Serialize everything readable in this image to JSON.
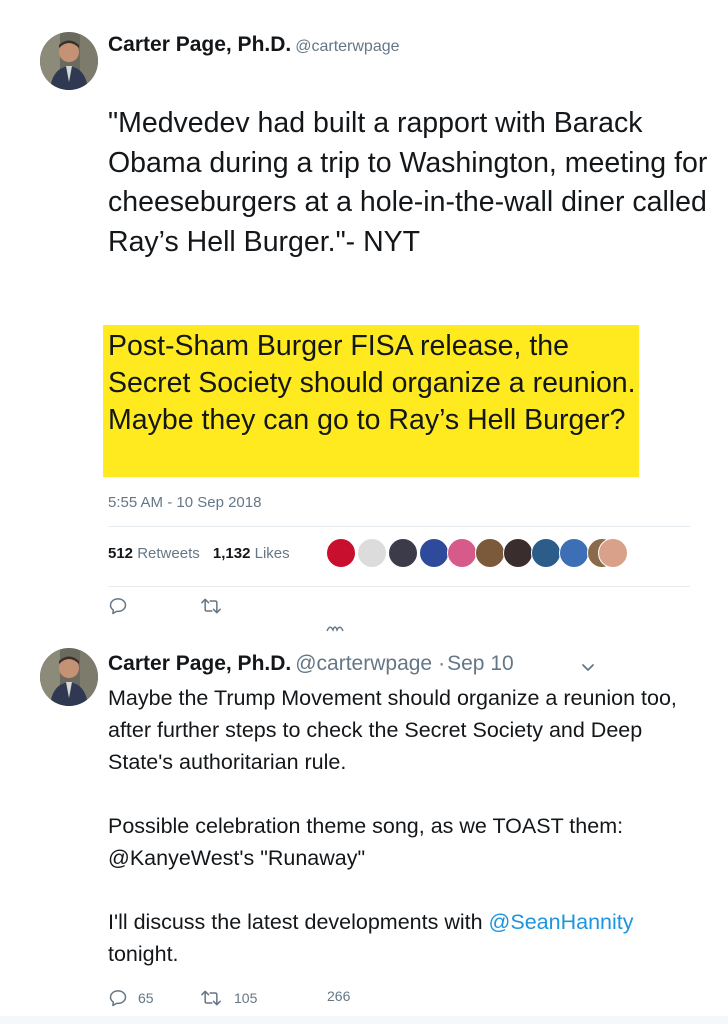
{
  "tweet1": {
    "author_name": "Carter Page, Ph.D.",
    "author_handle": "@carterwpage",
    "quote_text": "\"Medvedev had built a rapport with Barack Obama during a trip to Washington, meeting for cheeseburgers at a hole-in-the-wall diner called Ray’s Hell Burger.\"- NYT",
    "highlight_text": "Post-Sham Burger FISA release, the Secret Society should organize a reunion. Maybe they can go to Ray’s Hell Burger?",
    "timestamp": "5:55 AM - 10 Sep 2018",
    "retweets_count": "512",
    "retweets_label": "Retweets",
    "likes_count": "1,132",
    "likes_label": "Likes",
    "liker_colors": [
      "#c8102e",
      "#dcdcdc",
      "#3b3b4a",
      "#2e4b9b",
      "#d65a8a",
      "#7a5a3a",
      "#3a2d2d",
      "#2b5c8a",
      "#3c6fb5",
      "#8a6a4a",
      "#d9a08a"
    ]
  },
  "tweet2": {
    "author_name": "Carter Page, Ph.D.",
    "author_handle": "@carterwpage",
    "dot": "·",
    "date": "Sep 10",
    "line1": "Maybe the Trump Movement should organize a reunion too, after further steps to check the Secret Society and Deep State's authoritarian rule.",
    "line2": "Possible celebration theme song, as we TOAST them: @KanyeWest's \"Runaway\"",
    "line3_pre": "I'll discuss the latest developments with ",
    "line3_link": "@SeanHannity",
    "line3_post": " tonight.",
    "replies_count": "65",
    "retweets_count": "105",
    "likes_count": "266"
  },
  "icons": {
    "reply": "reply-icon",
    "retweet": "retweet-icon",
    "like": "heart-icon",
    "chevron": "chevron-down-icon"
  }
}
